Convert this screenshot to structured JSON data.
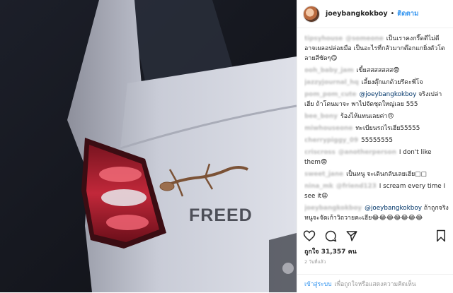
{
  "post": {
    "username": "joeybangkokboy",
    "separator": "•",
    "follow_label": "ติดตาม",
    "image_text": "FREED"
  },
  "comments": [
    {
      "user": "tipsyhouse",
      "mention": "@someone",
      "text": "เป็นเราคงกรี๊ดดีไม่ดีอาจเผลอปล่อยมือ เป็นอะไรที่กลัวมากต๊อกแกยิ่งตัวโตลายสีชัดๆ😋"
    },
    {
      "user": "ooh_baby_jam",
      "mention": "",
      "text": "เขี้ยสสสสสสส😨"
    },
    {
      "user": "jazzyjournal_hq",
      "mention": "",
      "text": "เลี้ยงตุ๊กแกด้วยรึคะพี่โจ"
    },
    {
      "user": "pom_pom_cute",
      "mention": "@joeybangkokboy",
      "text": "จริงเปล่าเฮีย ถ้าโดนมาจะ พาไปจัดชุดใหญ่เลย 555"
    },
    {
      "user": "bee_bony",
      "mention": "",
      "text": "ร้องไห้แทนเลยค่า😢"
    },
    {
      "user": "miwhouseone",
      "mention": "",
      "text": "ทะเบียนรถไรเฮีย55555"
    },
    {
      "user": "cherrypiggy_09",
      "mention": "",
      "text": "55555555"
    },
    {
      "user": "criscross",
      "mention": "@anotherperson",
      "text": "I don't like them😨"
    },
    {
      "user": "sweet_jane",
      "mention": "",
      "text": "เป็นหนู จะเดินกลับเลยเฮีย□□"
    },
    {
      "user": "nina_mk",
      "mention": "@friend123",
      "text": "I scream every time I see it😩"
    },
    {
      "user": "joeybangkokboy",
      "mention": "@joeybangkokboy",
      "text": "ถ้าถูกจริง หนูจะจัดเก้าวิถวายคะเฮีย😂😂😂😂😂😂😂"
    }
  ],
  "likes": {
    "label": "ถูกใจ",
    "count": "31,357",
    "unit": "คน"
  },
  "time_ago": "2 วันที่แล้ว",
  "footer": {
    "login": "เข้าสู่ระบบ",
    "rest": "เพื่อถูกใจหรือแสดงความคิดเห็น"
  }
}
